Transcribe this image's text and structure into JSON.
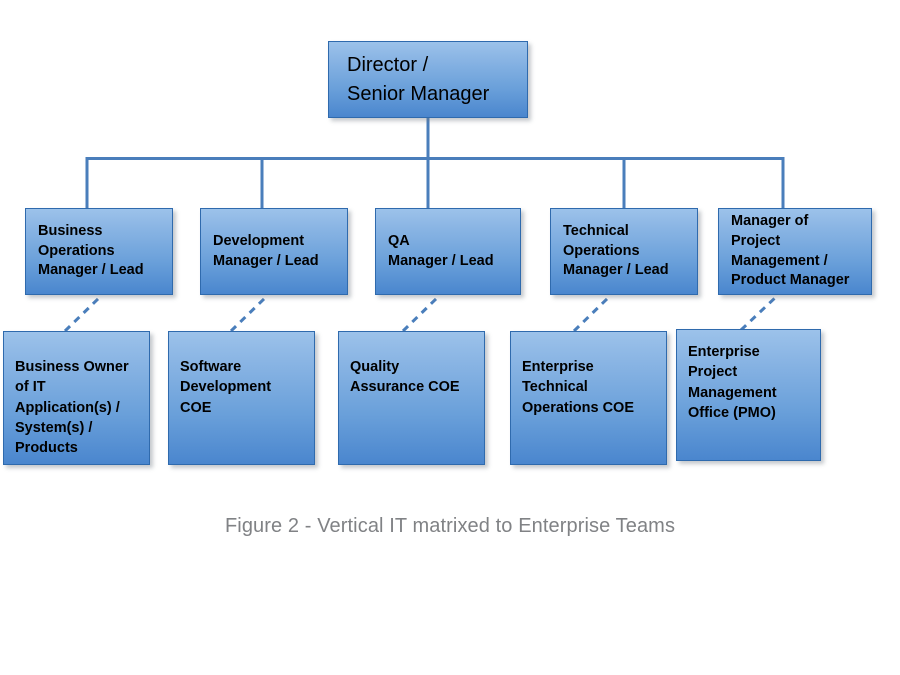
{
  "figure": {
    "caption": "Figure 2 - Vertical IT matrixed to Enterprise Teams",
    "caption_color": "#808285",
    "background_color": "#ffffff"
  },
  "style": {
    "box_fill_top": "#9cc2ea",
    "box_fill_bottom": "#4a86ce",
    "box_border": "#2f6aad",
    "connector_color": "#4a7ebb",
    "text_color": "#000000"
  },
  "chart_data": {
    "type": "diagram",
    "subtype": "organization-chart",
    "title": "Figure 2 - Vertical IT matrixed to Enterprise Teams",
    "levels": 3,
    "nodes": [
      {
        "id": "director",
        "level": 1,
        "label": "Director /\nSenior Manager"
      },
      {
        "id": "business-operations",
        "level": 2,
        "label": "Business\nOperations\nManager / Lead"
      },
      {
        "id": "development",
        "level": 2,
        "label": "Development\nManager / Lead"
      },
      {
        "id": "qa",
        "level": 2,
        "label": "QA\nManager / Lead"
      },
      {
        "id": "technical-operations",
        "level": 2,
        "label": "Technical\nOperations\nManager / Lead"
      },
      {
        "id": "project-management",
        "level": 2,
        "label": "Manager of Project\nManagement /\nProduct Manager"
      },
      {
        "id": "business-owner",
        "level": 3,
        "label": "Business Owner\nof IT\nApplication(s) /\nSystem(s) /\nProducts"
      },
      {
        "id": "software-development-coe",
        "level": 3,
        "label": "Software\nDevelopment\nCOE"
      },
      {
        "id": "quality-assurance-coe",
        "level": 3,
        "label": "Quality\nAssurance COE"
      },
      {
        "id": "enterprise-technical-operations-coe",
        "level": 3,
        "label": "Enterprise\nTechnical\nOperations COE"
      },
      {
        "id": "enterprise-pmo",
        "level": 3,
        "label": "Enterprise\nProject\nManagement\nOffice (PMO)"
      }
    ],
    "edges": [
      {
        "from": "director",
        "to": "business-operations",
        "style": "solid"
      },
      {
        "from": "director",
        "to": "development",
        "style": "solid"
      },
      {
        "from": "director",
        "to": "qa",
        "style": "solid"
      },
      {
        "from": "director",
        "to": "technical-operations",
        "style": "solid"
      },
      {
        "from": "director",
        "to": "project-management",
        "style": "solid"
      },
      {
        "from": "business-operations",
        "to": "business-owner",
        "style": "dashed"
      },
      {
        "from": "development",
        "to": "software-development-coe",
        "style": "dashed"
      },
      {
        "from": "qa",
        "to": "quality-assurance-coe",
        "style": "dashed"
      },
      {
        "from": "technical-operations",
        "to": "enterprise-technical-operations-coe",
        "style": "dashed"
      },
      {
        "from": "project-management",
        "to": "enterprise-pmo",
        "style": "dashed"
      }
    ]
  }
}
